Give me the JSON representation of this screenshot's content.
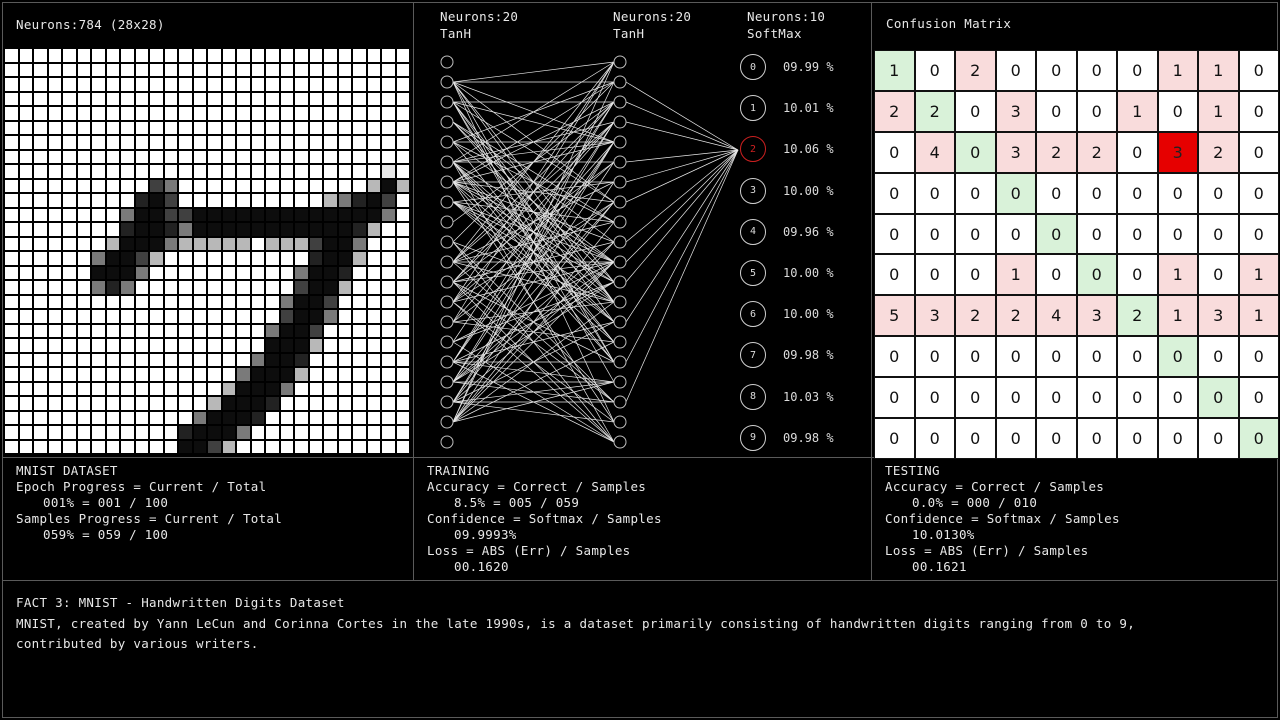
{
  "colors": {
    "accent_green": "#2ec42e",
    "correct_cell": "#d9f2d9",
    "error_cell": "#f9dcdc",
    "highlight_cell": "#e60000",
    "highlight_output": "#cc2020"
  },
  "input_panel": {
    "header": "Neurons:784 (28x28)",
    "digit_rows": [
      "............................",
      "............................",
      "............................",
      "............................",
      "............................",
      "............................",
      "............................",
      "............................",
      "..........................',",
      "..........%+.............:@:",
      ".........#@%..........:+#@%.",
      "........+@@%%@@@@@@@@@@@@@+.",
      "........#@@#+@@@@@@@@@@@#:..",
      ".......:@@@+:::::.:::%@@+...",
      "......+@@%:..........#@@:...",
      "......@@@+..........+@@#....",
      "......+#+...........%@@:....",
      "...................+@@%.....",
      "...................%@@+.....",
      "..................+@@%......",
      "..................@@@:......",
      ".................+@@#.......",
      "................+@@@:.......",
      "...............:@@@+........",
      "..............:@@@#.........",
      ".............+@@@#..........",
      "............#@@@+...........",
      "............@@%:............"
    ]
  },
  "network_panel": {
    "hidden1_label": "Neurons:20",
    "hidden1_activation": "TanH",
    "hidden2_label": "Neurons:20",
    "hidden2_activation": "TanH",
    "output_label": "Neurons:10",
    "output_activation": "SoftMax",
    "outputs": [
      {
        "digit": "0",
        "pct": "09.99 %"
      },
      {
        "digit": "1",
        "pct": "10.01 %"
      },
      {
        "digit": "2",
        "pct": "10.06 %"
      },
      {
        "digit": "3",
        "pct": "10.00 %"
      },
      {
        "digit": "4",
        "pct": "09.96 %"
      },
      {
        "digit": "5",
        "pct": "10.00 %"
      },
      {
        "digit": "6",
        "pct": "10.00 %"
      },
      {
        "digit": "7",
        "pct": "09.98 %"
      },
      {
        "digit": "8",
        "pct": "10.03 %"
      },
      {
        "digit": "9",
        "pct": "09.98 %"
      }
    ],
    "predicted_index": 2
  },
  "confusion_panel": {
    "header": "Confusion Matrix",
    "matrix": [
      [
        1,
        0,
        2,
        0,
        0,
        0,
        0,
        1,
        1,
        0
      ],
      [
        2,
        2,
        0,
        3,
        0,
        0,
        1,
        0,
        1,
        0
      ],
      [
        0,
        4,
        0,
        3,
        2,
        2,
        0,
        3,
        2,
        0
      ],
      [
        0,
        0,
        0,
        0,
        0,
        0,
        0,
        0,
        0,
        0
      ],
      [
        0,
        0,
        0,
        0,
        0,
        0,
        0,
        0,
        0,
        0
      ],
      [
        0,
        0,
        0,
        1,
        0,
        0,
        0,
        1,
        0,
        1
      ],
      [
        5,
        3,
        2,
        2,
        4,
        3,
        2,
        1,
        3,
        1
      ],
      [
        0,
        0,
        0,
        0,
        0,
        0,
        0,
        0,
        0,
        0
      ],
      [
        0,
        0,
        0,
        0,
        0,
        0,
        0,
        0,
        0,
        0
      ],
      [
        0,
        0,
        0,
        0,
        0,
        0,
        0,
        0,
        0,
        0
      ]
    ],
    "highlight": {
      "row": 2,
      "col": 7
    }
  },
  "dataset_stats": {
    "title": "MNIST DATASET",
    "line1": "Epoch Progress = Current / Total",
    "line2": "001% = 001 / 100",
    "line3": "Samples Progress = Current / Total",
    "line4": "059% = 059 / 100"
  },
  "training_stats": {
    "title": "TRAINING",
    "line1": "Accuracy = Correct / Samples",
    "line2": "8.5% = 005 / 059",
    "line3": "Confidence = Softmax / Samples",
    "line4": "09.9993%",
    "line5": "Loss = ABS (Err) / Samples",
    "line6": "00.1620"
  },
  "testing_stats": {
    "title": "TESTING",
    "line1": "Accuracy = Correct / Samples",
    "line2": "0.0% = 000 / 010",
    "line3": "Confidence = Softmax / Samples",
    "line4": "10.0130%",
    "line5": "Loss = ABS (Err) / Samples",
    "line6": "00.1621"
  },
  "fact": {
    "title": "FACT 3: MNIST - Handwritten Digits Dataset",
    "text": "MNIST, created by Yann LeCun and Corinna Cortes in the late 1990s, is a dataset primarily consisting of handwritten digits ranging from 0 to 9, contributed by various writers."
  }
}
